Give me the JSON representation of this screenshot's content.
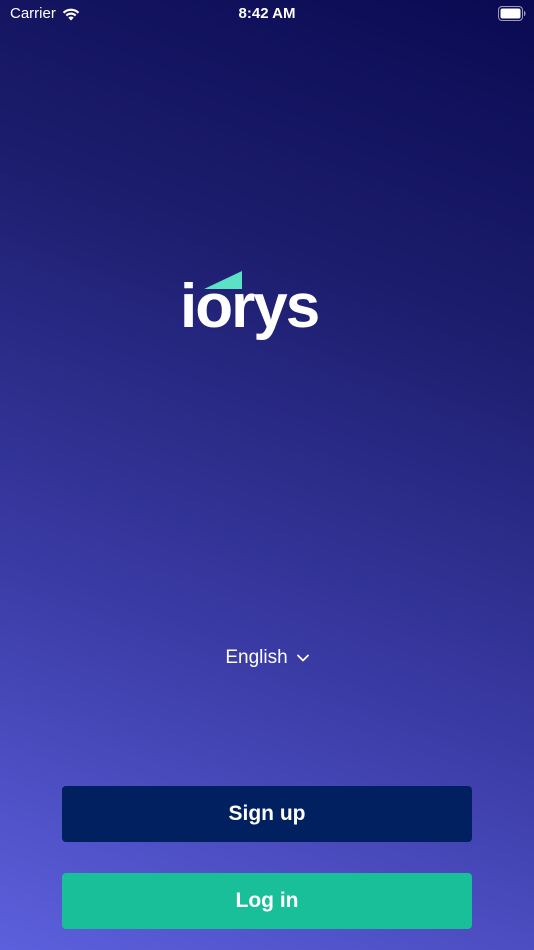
{
  "status_bar": {
    "carrier": "Carrier",
    "time": "8:42 AM"
  },
  "logo": {
    "wordmark": "iorys",
    "accent_color": "#5ce1c6"
  },
  "language": {
    "selected": "English"
  },
  "buttons": {
    "signup_label": "Sign up",
    "login_label": "Log in"
  },
  "colors": {
    "signup_bg": "#012060",
    "login_bg": "#18bf99"
  }
}
